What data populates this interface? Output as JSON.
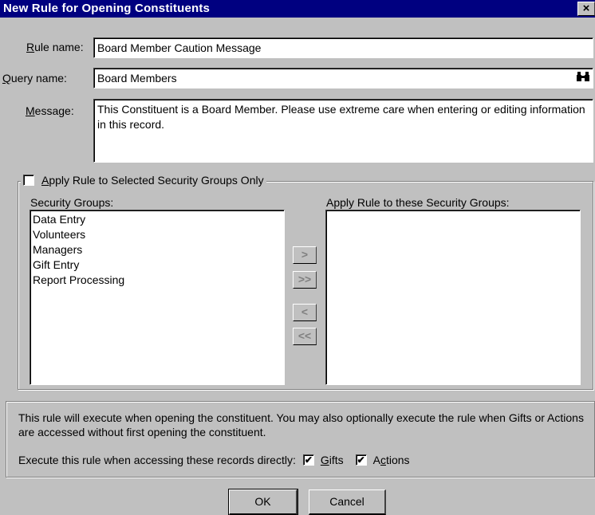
{
  "window": {
    "title": "New Rule for Opening Constituents",
    "close_glyph": "×"
  },
  "form": {
    "rule_name_label_first": "R",
    "rule_name_label_rest": "ule name:",
    "rule_name_value": "Board Member Caution Message",
    "query_name_label_first": "Q",
    "query_name_label_rest": "uery name:",
    "query_name_value": "Board Members",
    "message_label_first": "M",
    "message_label_rest": "essage:",
    "message_value": "This Constituent is a Board Member.  Please use extreme care when entering or editing information in this record."
  },
  "security": {
    "apply_checkbox_first": "A",
    "apply_checkbox_rest": "pply Rule to Selected Security Groups Only",
    "apply_checked": false,
    "left_label": "Security Groups:",
    "right_label": "Apply Rule to these Security Groups:",
    "groups": [
      "Data Entry",
      "Volunteers",
      "Managers",
      "Gift Entry",
      "Report Processing"
    ],
    "selected_groups": [],
    "move_buttons": {
      "add": ">",
      "add_all": ">>",
      "remove": "<",
      "remove_all": "<<"
    }
  },
  "info": {
    "description": "This rule will execute when opening the constituent.  You may also optionally execute the rule when Gifts or Actions are accessed without first opening the constituent.",
    "execute_label": "Execute this rule when accessing these records directly:",
    "gifts_first": "G",
    "gifts_rest": "ifts",
    "gifts_checked": true,
    "actions_first": "A",
    "actions_mid": "c",
    "actions_rest": "tions",
    "actions_checked": true
  },
  "buttons": {
    "ok": "OK",
    "cancel": "Cancel"
  },
  "icons": {
    "check": "✔",
    "binoculars": "binoculars-icon"
  }
}
